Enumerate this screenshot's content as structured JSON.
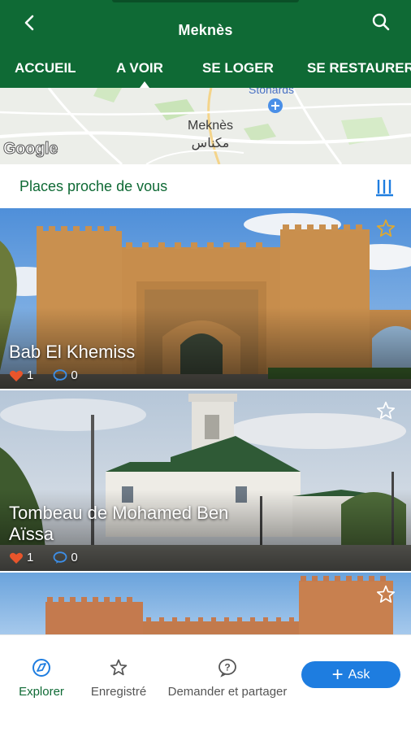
{
  "header": {
    "title": "Meknès"
  },
  "tabs": [
    {
      "label": "ACCUEIL"
    },
    {
      "label": "A VOIR"
    },
    {
      "label": "SE LOGER"
    },
    {
      "label": "SE RESTAURER"
    }
  ],
  "map": {
    "city_latin": "Meknès",
    "city_arabic": "مكناس",
    "top_label": "Stonards",
    "logo": "Google"
  },
  "places": {
    "title": "Places proche de vous"
  },
  "cards": [
    {
      "title": "Bab El Khemiss",
      "likes": "1",
      "comments": "0"
    },
    {
      "title": "Tombeau de Mohamed Ben Aïssa",
      "likes": "1",
      "comments": "0"
    },
    {
      "title": "",
      "likes": "",
      "comments": ""
    }
  ],
  "nav": {
    "explorer": "Explorer",
    "saved": "Enregistré",
    "ask_share": "Demander et partager",
    "ask_button": "Ask"
  },
  "colors": {
    "brand_green": "#0f6a35",
    "ask_blue": "#1e7de0",
    "like_red": "#e8552b"
  }
}
